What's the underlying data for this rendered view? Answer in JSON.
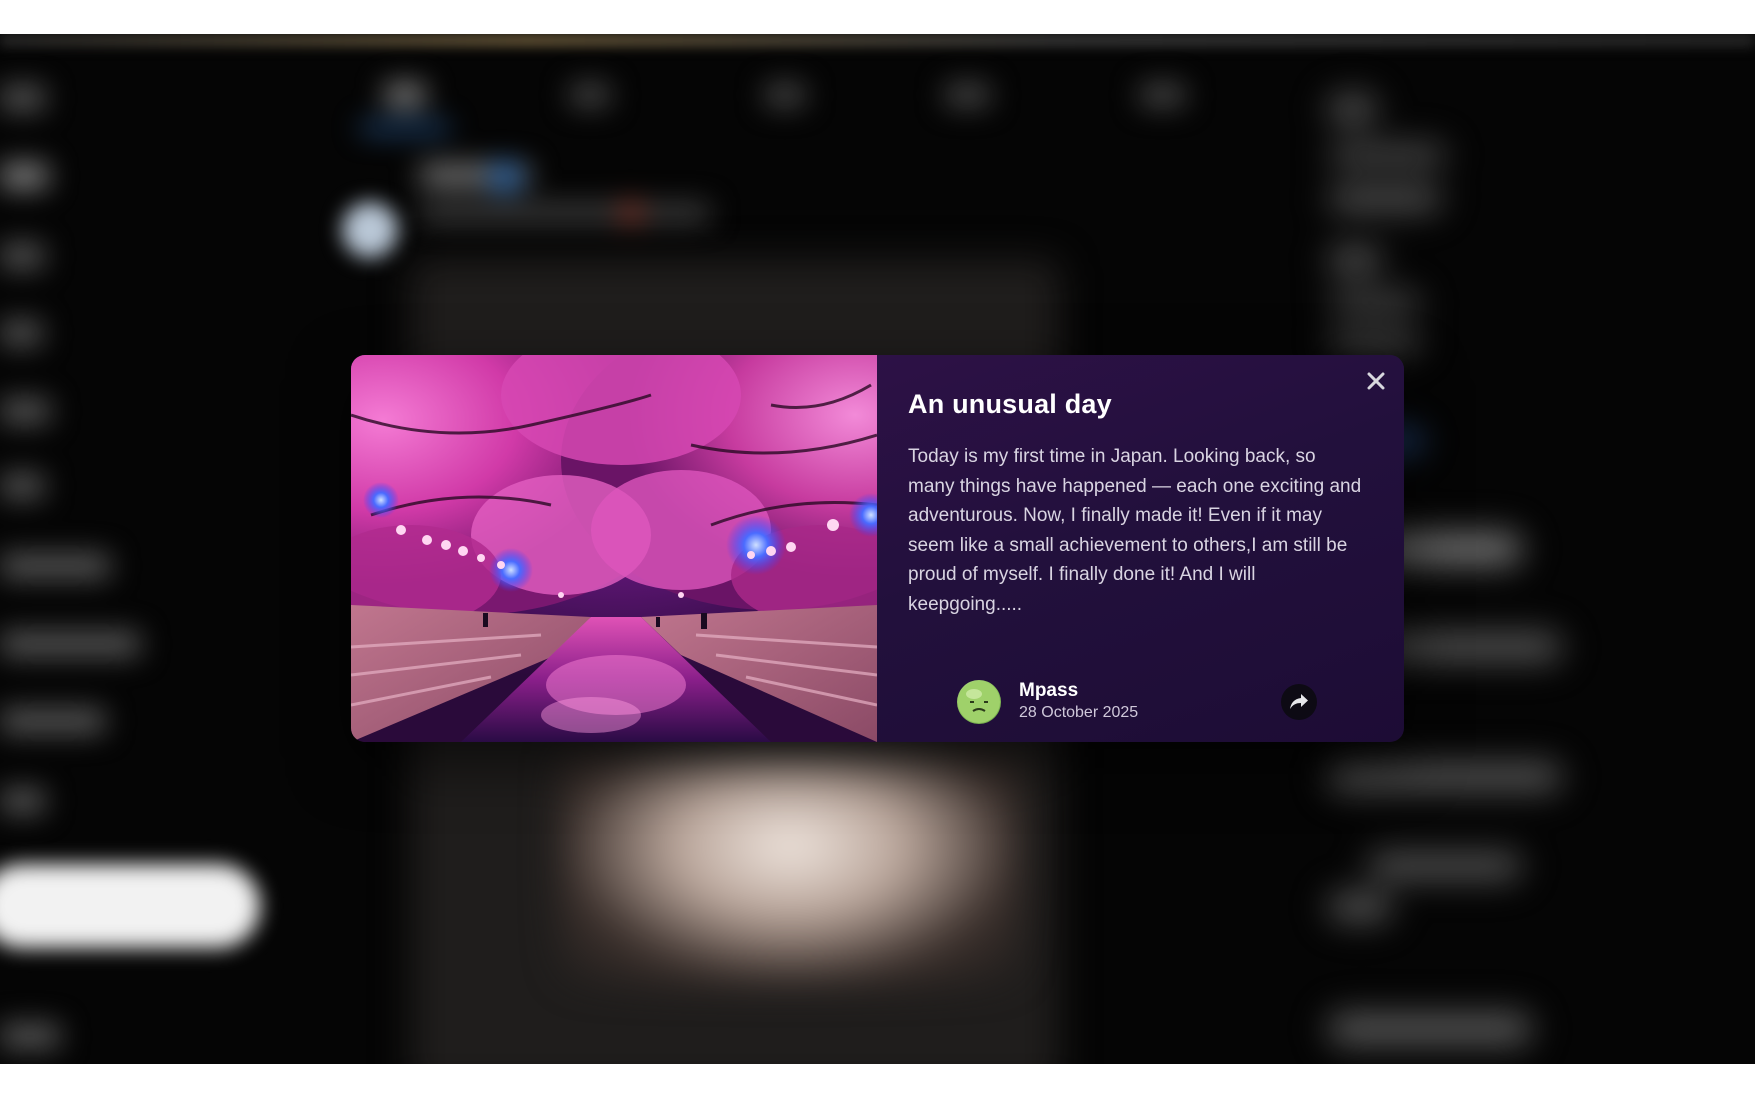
{
  "post": {
    "title": "An unusual day",
    "body": "Today is my first time in Japan. Looking back, so many things have happened — each one exciting and adventurous. Now, I finally made it! Even if it may seem like a small achievement to others,I am still be proud of myself. I finally done it! And I will keepgoing.....",
    "author": {
      "name": "Mpass",
      "date": "28 October 2025"
    }
  },
  "icons": {
    "close": "close-icon",
    "share": "share-icon",
    "avatar": "avatar"
  },
  "colors": {
    "modal_bg": "#22103c",
    "title": "#ffffff",
    "body_text": "#d9d4e2",
    "share_button_bg": "#0d0a14"
  }
}
